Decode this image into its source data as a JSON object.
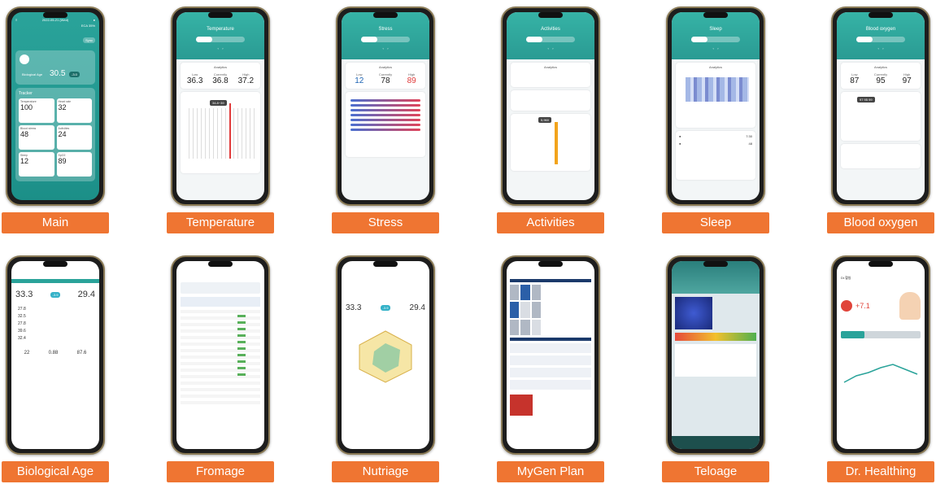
{
  "labels": [
    "Main",
    "Temperature",
    "Stress",
    "Activities",
    "Sleep",
    "Blood oxygen",
    "Biological Age",
    "Fromage",
    "Nutriage",
    "MyGen Plan",
    "Teloage",
    "Dr. Healthing"
  ],
  "main": {
    "date": "2022-05-21 (Wed)",
    "battery": "ECA 35%",
    "sync": "Sync",
    "bio_label": "Biological Age",
    "bio_value": "30.5",
    "bio_delta": "-3.0",
    "tracker": "Tracker",
    "tiles": [
      {
        "name": "Temperature",
        "value": "100"
      },
      {
        "name": "Heart rate",
        "value": "32"
      },
      {
        "name": "Blood stress",
        "value": "48"
      },
      {
        "name": "Activities",
        "value": "24"
      },
      {
        "name": "Sleep",
        "value": "12"
      },
      {
        "name": "SpO2",
        "value": "89"
      }
    ]
  },
  "temperature": {
    "title": "Temperature",
    "analytics": "Analytics",
    "low_label": "Low",
    "cur_label": "Currently",
    "high_label": "High",
    "low": "36.3",
    "cur": "36.8",
    "high": "37.2",
    "tooltip": "34.8~39"
  },
  "stress": {
    "title": "Stress",
    "analytics": "Analytics",
    "low_label": "Low",
    "cur_label": "Currently",
    "high_label": "High",
    "low": "12",
    "cur": "78",
    "high": "89"
  },
  "activities": {
    "title": "Activities",
    "analytics": "Analytics",
    "tooltip": "5,960"
  },
  "sleep": {
    "title": "Sleep",
    "analytics": "Analytics",
    "total": "7:30",
    "eff": "48"
  },
  "oxygen": {
    "title": "Blood oxygen",
    "analytics": "Analytics",
    "low_label": "Low",
    "cur_label": "Currently",
    "high_label": "High",
    "low": "87",
    "cur": "95",
    "high": "97",
    "tooltip": "97 95 99"
  },
  "bioage": {
    "bio": "33.3",
    "delta": "-3.9",
    "real": "29.4",
    "rows": [
      "27.8",
      "32.5",
      "27.8",
      "39.6",
      "32.4"
    ],
    "gauges": [
      "22",
      "0.88",
      "87.6"
    ]
  },
  "nutri": {
    "left": "33.3",
    "delta": "-3.9",
    "right": "29.4"
  },
  "dr": {
    "title": "Dr.헬씽",
    "value": "+7.1"
  },
  "colors": {
    "accent": "#2aa39a",
    "label_bg": "#ef7532",
    "stress_high": "#e03a3a",
    "low_blue": "#1e64b4"
  }
}
